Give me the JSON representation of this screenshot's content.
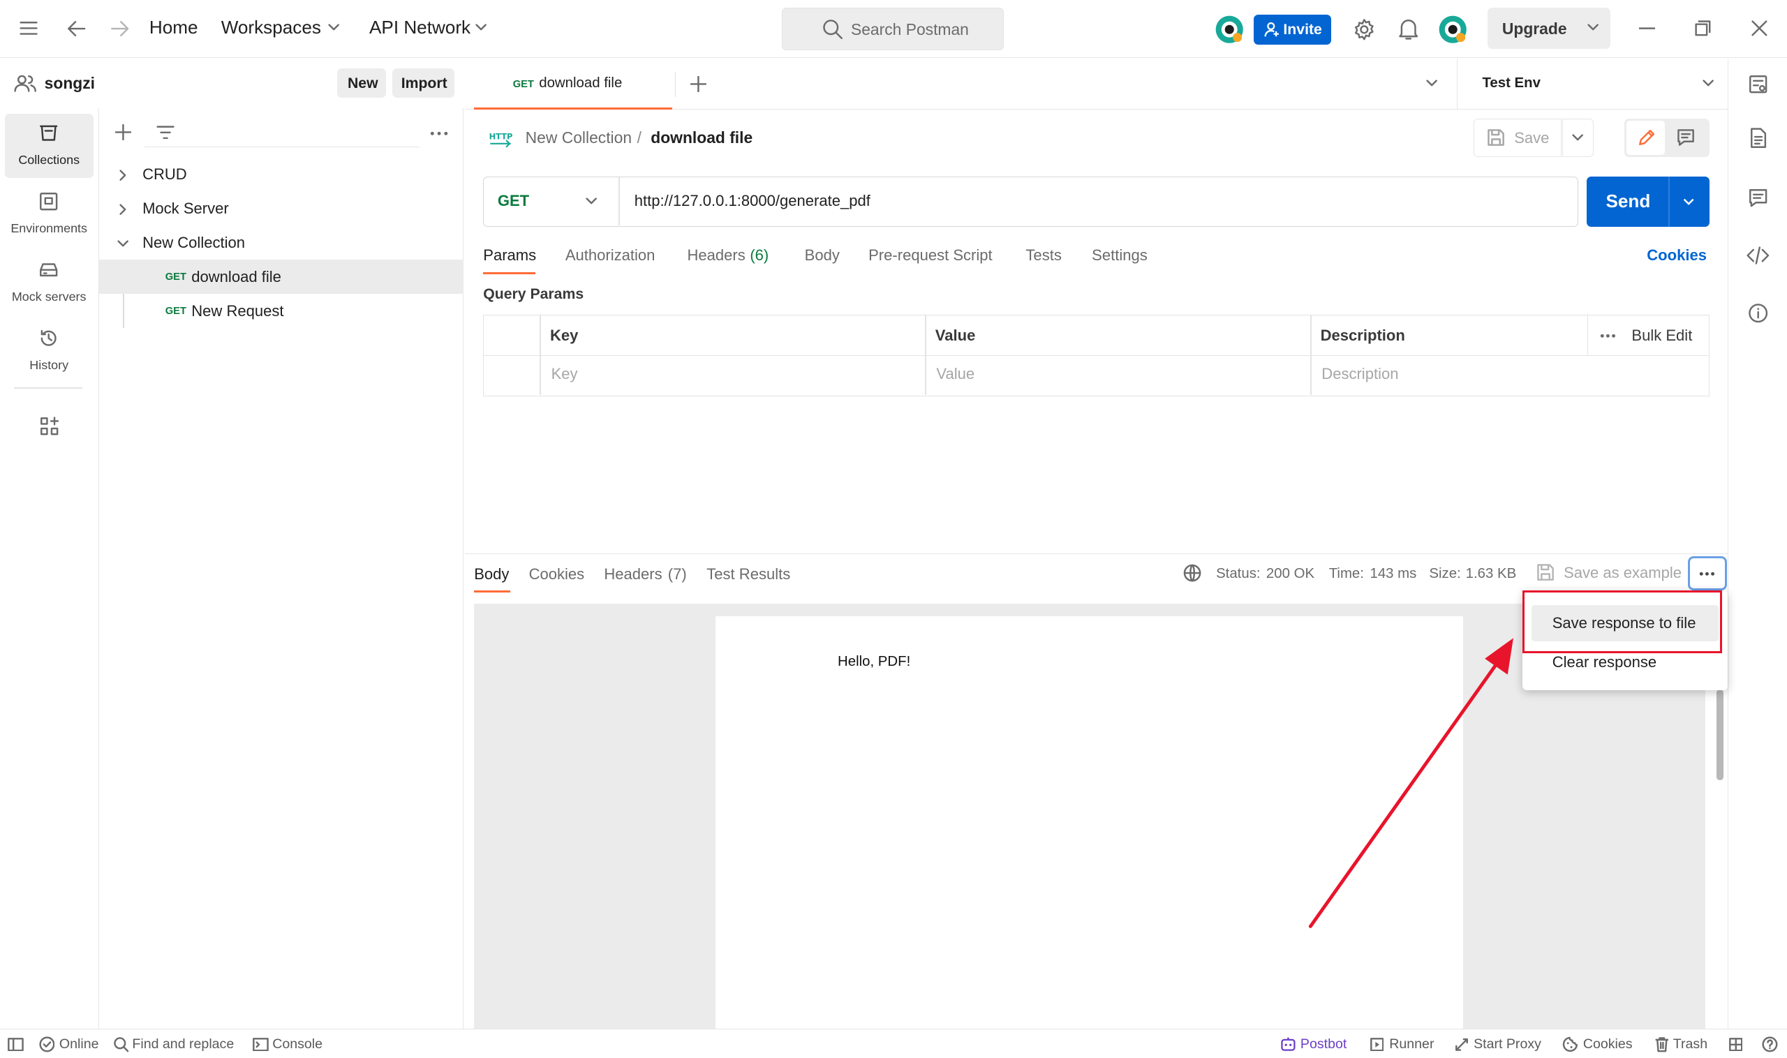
{
  "topbar": {
    "home": "Home",
    "workspaces": "Workspaces",
    "api_network": "API Network",
    "search_placeholder": "Search Postman",
    "invite": "Invite",
    "upgrade": "Upgrade"
  },
  "workspace": {
    "name": "songzi",
    "new_label": "New",
    "import_label": "Import"
  },
  "rail": [
    {
      "label": "Collections"
    },
    {
      "label": "Environments"
    },
    {
      "label": "Mock servers"
    },
    {
      "label": "History"
    }
  ],
  "tree": {
    "items": [
      {
        "label": "CRUD"
      },
      {
        "label": "Mock Server"
      },
      {
        "label": "New Collection"
      }
    ],
    "requests": [
      {
        "method": "GET",
        "label": "download file"
      },
      {
        "method": "GET",
        "label": "New Request"
      }
    ]
  },
  "tab": {
    "method": "GET",
    "label": "download file"
  },
  "env": {
    "name": "Test Env"
  },
  "breadcrumb": {
    "collection": "New Collection",
    "separator": "/",
    "request": "download file"
  },
  "request": {
    "method": "GET",
    "url": "http://127.0.0.1:8000/generate_pdf",
    "save_label": "Save",
    "send_label": "Send"
  },
  "req_tabs": {
    "params": "Params",
    "authorization": "Authorization",
    "headers": "Headers",
    "headers_count": "(6)",
    "body": "Body",
    "prerequest": "Pre-request Script",
    "tests": "Tests",
    "settings": "Settings",
    "cookies": "Cookies"
  },
  "query_params": {
    "title": "Query Params",
    "headers": {
      "key": "Key",
      "value": "Value",
      "description": "Description",
      "bulk_edit": "Bulk Edit"
    },
    "placeholders": {
      "key": "Key",
      "value": "Value",
      "description": "Description"
    }
  },
  "response": {
    "tabs": {
      "body": "Body",
      "cookies": "Cookies",
      "headers": "Headers",
      "headers_count": "(7)",
      "test_results": "Test Results"
    },
    "status_label": "Status:",
    "status_value": "200 OK",
    "time_label": "Time:",
    "time_value": "143 ms",
    "size_label": "Size:",
    "size_value": "1.63 KB",
    "save_example": "Save as example",
    "pdf_text": "Hello, PDF!"
  },
  "menu": {
    "items": [
      {
        "label": "Save response to file"
      },
      {
        "label": "Clear response"
      }
    ]
  },
  "statusbar": {
    "online": "Online",
    "find_replace": "Find and replace",
    "console": "Console",
    "postbot": "Postbot",
    "runner": "Runner",
    "start_proxy": "Start Proxy",
    "cookies": "Cookies",
    "trash": "Trash"
  },
  "colors": {
    "accent_blue": "#0265d2",
    "get_green": "#0b7b3e",
    "annotation_red": "#e8142b",
    "postbot_purple": "#6a3fc8"
  }
}
